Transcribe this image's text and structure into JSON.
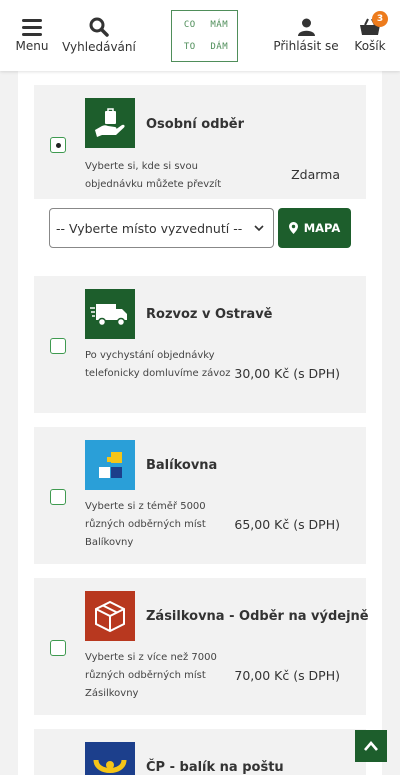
{
  "header": {
    "menu_label": "Menu",
    "search_label": "Vyhledávání",
    "login_label": "Přihlásit se",
    "cart_label": "Košík",
    "cart_count": "3",
    "logo_words": [
      "CO",
      "MÁM",
      "TO",
      "DÁM"
    ],
    "brand_color": "#4f8e5a"
  },
  "pickup": {
    "select_placeholder": "-- Vyberte místo vyzvednutí --",
    "map_label": "MAPA"
  },
  "shipping": [
    {
      "title": "Osobní odběr",
      "desc": "Vyberte si, kde si svou objednávku můžete převzít",
      "price": "Zdarma",
      "selected": true,
      "icon": "hand-package-icon"
    },
    {
      "title": "Rozvoz v Ostravě",
      "desc": "Po vychystání objednávky telefonicky domluvíme závoz",
      "price": "30,00 Kč (s DPH)",
      "selected": false,
      "icon": "delivery-truck-icon"
    },
    {
      "title": "Balíkovna",
      "desc": "Vyberte si z téměř 5000 různých odběrných míst Balíkovny",
      "price": "65,00 Kč (s DPH)",
      "selected": false,
      "icon": "balikovna-logo-icon"
    },
    {
      "title": "Zásilkovna - Odběr na výdejně",
      "desc": "Vyberte si z více než 7000 různých odběrných míst Zásilkovny",
      "price": "70,00 Kč (s DPH)",
      "selected": false,
      "icon": "zasilkovna-box-icon"
    },
    {
      "title": "ČP - balík na poštu",
      "desc": "",
      "price": "",
      "selected": false,
      "icon": "posthorn-icon"
    }
  ],
  "colors": {
    "accent": "#1d5e2c",
    "radio_border": "#3f9a50",
    "badge": "#ed7b1c"
  }
}
